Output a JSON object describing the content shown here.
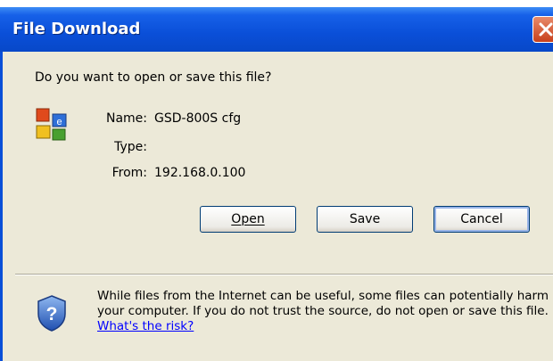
{
  "window": {
    "title": "File Download",
    "close_icon": "close-icon"
  },
  "dialog": {
    "question": "Do you want to open or save this file?",
    "file": {
      "icon": "file-type-icon",
      "name_label": "Name:",
      "name_value": "GSD-800S cfg",
      "type_label": "Type:",
      "type_value": "",
      "from_label": "From:",
      "from_value": "192.168.0.100"
    },
    "buttons": {
      "open": "Open",
      "save": "Save",
      "cancel": "Cancel"
    },
    "warning": {
      "icon": "shield-question-icon",
      "text": "While files from the Internet can be useful, some files can potentially harm your computer. If you do not trust the source, do not open or save this file.",
      "link": "What's the risk?"
    }
  },
  "colors": {
    "titlebar": "#0a4fd8",
    "body": "#ece9d8",
    "link": "#0000ff",
    "close": "#d0502a"
  }
}
